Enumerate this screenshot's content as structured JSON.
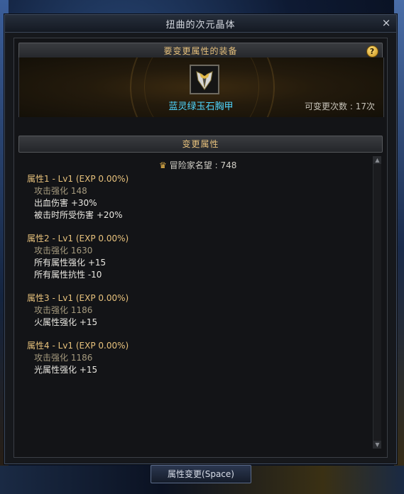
{
  "window": {
    "title": "扭曲的次元晶体",
    "close_glyph": "×"
  },
  "equip_section": {
    "header": "要变更属性的装备",
    "help_glyph": "?",
    "item_name": "蓝灵绿玉石胸甲",
    "change_count": "可变更次数 : 17次"
  },
  "change_section": {
    "header": "变更属性",
    "fame_label": "冒险家名望 : 748"
  },
  "attributes": [
    {
      "title": "属性1 - Lv1 (EXP 0.00%)",
      "base": "攻击强化 148",
      "stats": [
        "出血伤害 +30%",
        "被击时所受伤害 +20%"
      ]
    },
    {
      "title": "属性2 - Lv1 (EXP 0.00%)",
      "base": "攻击强化 1630",
      "stats": [
        "所有属性强化 +15",
        "所有属性抗性 -10"
      ]
    },
    {
      "title": "属性3 - Lv1 (EXP 0.00%)",
      "base": "攻击强化 1186",
      "stats": [
        "火属性强化 +15"
      ]
    },
    {
      "title": "属性4 - Lv1 (EXP 0.00%)",
      "base": "攻击强化 1186",
      "stats": [
        "光属性强化 +15"
      ]
    }
  ],
  "action_button": {
    "label": "属性变更(Space)"
  },
  "colors": {
    "item_name": "#4fd6ff",
    "header_text": "#e6c07c",
    "attr_title": "#e8c27c"
  },
  "icons": {
    "item": "chest-armor-icon",
    "fame": "fame-emblem-icon"
  }
}
